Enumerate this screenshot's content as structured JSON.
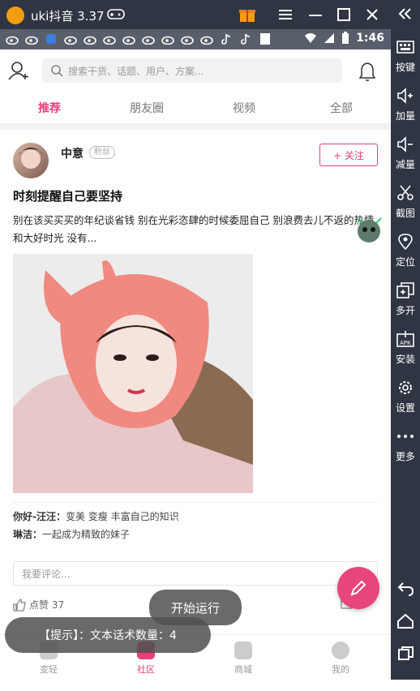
{
  "window": {
    "title": "uki抖音 3.37",
    "status_time": "1:46",
    "status_icons": [
      "weibo-icon",
      "weibo-icon",
      "app-icon",
      "weibo-icon",
      "weibo-icon",
      "weibo-icon",
      "weibo-icon",
      "weibo-icon",
      "weibo-icon",
      "weibo-icon",
      "weibo-icon",
      "tiktok-icon",
      "tiktok-icon",
      "square-icon"
    ]
  },
  "sidebar": {
    "items": [
      {
        "label": "按键",
        "icon": "keyboard-icon"
      },
      {
        "label": "加量",
        "icon": "volume-up-icon"
      },
      {
        "label": "减量",
        "icon": "volume-down-icon"
      },
      {
        "label": "截图",
        "icon": "scissors-icon"
      },
      {
        "label": "定位",
        "icon": "location-icon"
      },
      {
        "label": "多开",
        "icon": "multi-open-icon"
      },
      {
        "label": "安装",
        "icon": "apk-install-icon"
      },
      {
        "label": "设置",
        "icon": "gear-icon"
      },
      {
        "label": "更多",
        "icon": "more-icon"
      }
    ]
  },
  "search": {
    "placeholder": "搜索干货、话题、用户、方案..."
  },
  "tabs": [
    "推荐",
    "朋友圈",
    "视频",
    "全部"
  ],
  "post": {
    "username": "中意",
    "badge": "粉丝",
    "follow_label": "+ 关注",
    "title": "时刻提醒自己要坚持",
    "body": "别在该买买买的年纪谈省钱 别在光彩恣肆的时候委屈自己 别浪费去儿不返的热情和大好时光 没有...",
    "comments": [
      {
        "author": "你好-汪汪：",
        "text": "变美 变瘦 丰富自己的知识"
      },
      {
        "author": "琳洁：",
        "text": "一起成为精致的妹子"
      }
    ],
    "comment_placeholder": "我要评论...",
    "likes": "点赞 37",
    "share": "享"
  },
  "bottom_nav": [
    "变轻",
    "社区",
    "商城",
    "我的"
  ],
  "toasts": {
    "run": "开始运行",
    "hint": "【提示】：文本话术数量：4"
  }
}
